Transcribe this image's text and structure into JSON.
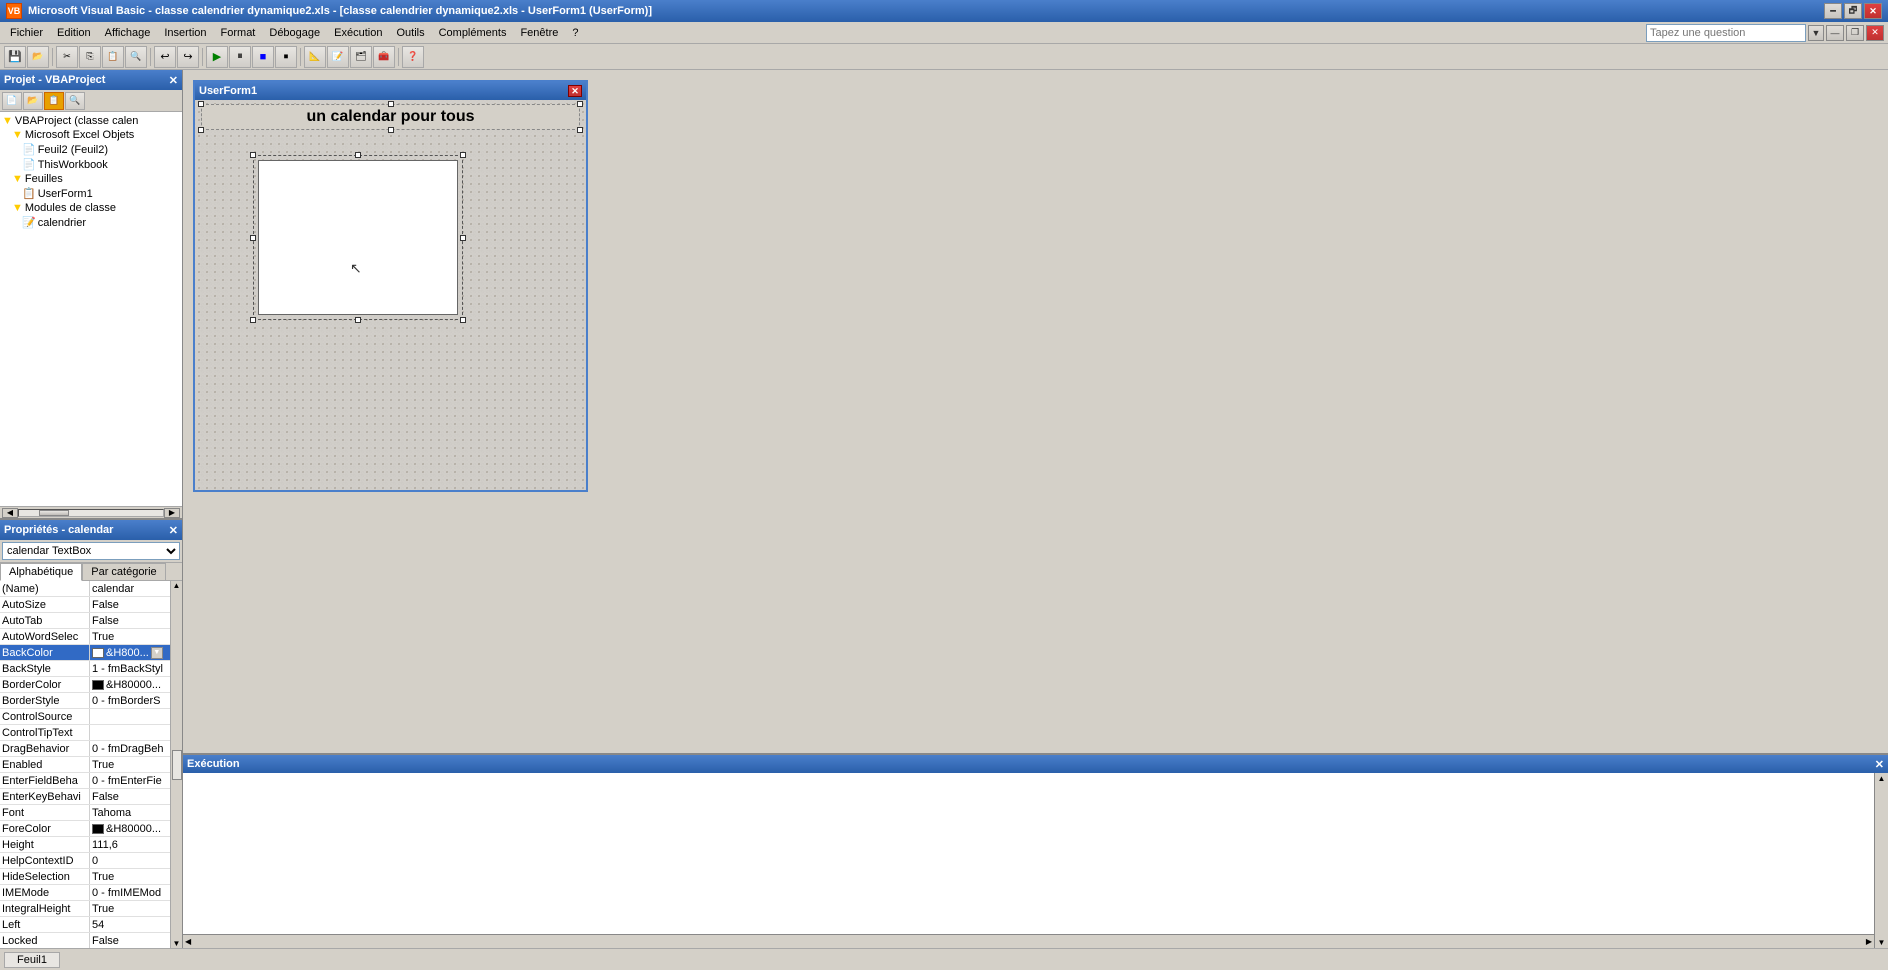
{
  "app": {
    "title": "Microsoft Visual Basic - classe calendrier dynamique2.xls - [classe calendrier dynamique2.xls - UserForm1 (UserForm)]",
    "icon": "VB"
  },
  "titlebar": {
    "minimize": "🗕",
    "restore": "🗗",
    "close": "✕",
    "inner_minimize": "—",
    "inner_restore": "❐",
    "inner_close": "✕"
  },
  "menu": {
    "items": [
      "Fichier",
      "Edition",
      "Affichage",
      "Insertion",
      "Format",
      "Débogage",
      "Exécution",
      "Outils",
      "Compléments",
      "Fenêtre",
      "?"
    ],
    "question_placeholder": "Tapez une question"
  },
  "project_panel": {
    "title": "Projet - VBAProject",
    "close": "✕",
    "tree": [
      {
        "level": 0,
        "icon": "▼",
        "text": "VBAProject (classe calen",
        "type": "project"
      },
      {
        "level": 1,
        "icon": "▼",
        "text": "Microsoft Excel Objets",
        "type": "folder"
      },
      {
        "level": 2,
        "icon": "📄",
        "text": "Feuil2 (Feuil2)",
        "type": "sheet"
      },
      {
        "level": 2,
        "icon": "📄",
        "text": "ThisWorkbook",
        "type": "workbook"
      },
      {
        "level": 1,
        "icon": "▼",
        "text": "Feuilles",
        "type": "folder"
      },
      {
        "level": 2,
        "icon": "📋",
        "text": "UserForm1",
        "type": "userform"
      },
      {
        "level": 1,
        "icon": "▼",
        "text": "Modules de classe",
        "type": "folder"
      },
      {
        "level": 2,
        "icon": "📝",
        "text": "calendrier",
        "type": "module"
      }
    ]
  },
  "properties_panel": {
    "title": "Propriétés - calendar",
    "close": "✕",
    "selector": "calendar TextBox",
    "tabs": [
      "Alphabétique",
      "Par catégorie"
    ],
    "active_tab": 0,
    "properties": [
      {
        "name": "(Name)",
        "value": "calendar"
      },
      {
        "name": "AutoSize",
        "value": "False"
      },
      {
        "name": "AutoTab",
        "value": "False"
      },
      {
        "name": "AutoWordSelec",
        "value": "True"
      },
      {
        "name": "BackColor",
        "value": "&H800...",
        "has_swatch": true,
        "swatch_color": "#ffffff",
        "has_dropdown": true
      },
      {
        "name": "BackStyle",
        "value": "1 - fmBackStyl"
      },
      {
        "name": "BorderColor",
        "value": "&H80000...",
        "has_swatch": true,
        "swatch_color": "#000000",
        "has_dropdown": false
      },
      {
        "name": "BorderStyle",
        "value": "0 - fmBorderS"
      },
      {
        "name": "ControlSource",
        "value": ""
      },
      {
        "name": "ControlTipText",
        "value": ""
      },
      {
        "name": "DragBehavior",
        "value": "0 - fmDragBeh"
      },
      {
        "name": "Enabled",
        "value": "True"
      },
      {
        "name": "EnterFieldBeha",
        "value": "0 - fmEnterFie"
      },
      {
        "name": "EnterKeyBehavi",
        "value": "False"
      },
      {
        "name": "Font",
        "value": "Tahoma"
      },
      {
        "name": "ForeColor",
        "value": "&H80000...",
        "has_swatch": true,
        "swatch_color": "#000000",
        "has_dropdown": false
      },
      {
        "name": "Height",
        "value": "111,6"
      },
      {
        "name": "HelpContextID",
        "value": "0"
      },
      {
        "name": "HideSelection",
        "value": "True"
      },
      {
        "name": "IMEMode",
        "value": "0 - fmIMEMod"
      },
      {
        "name": "IntegralHeight",
        "value": "True"
      },
      {
        "name": "Left",
        "value": "54"
      },
      {
        "name": "Locked",
        "value": "False"
      }
    ]
  },
  "userform": {
    "title": "UserForm1",
    "label_text": "un calendar  pour tous"
  },
  "execution_panel": {
    "title": "Exécution",
    "close": "✕"
  },
  "status_bar": {
    "tab": "Feuil1"
  }
}
